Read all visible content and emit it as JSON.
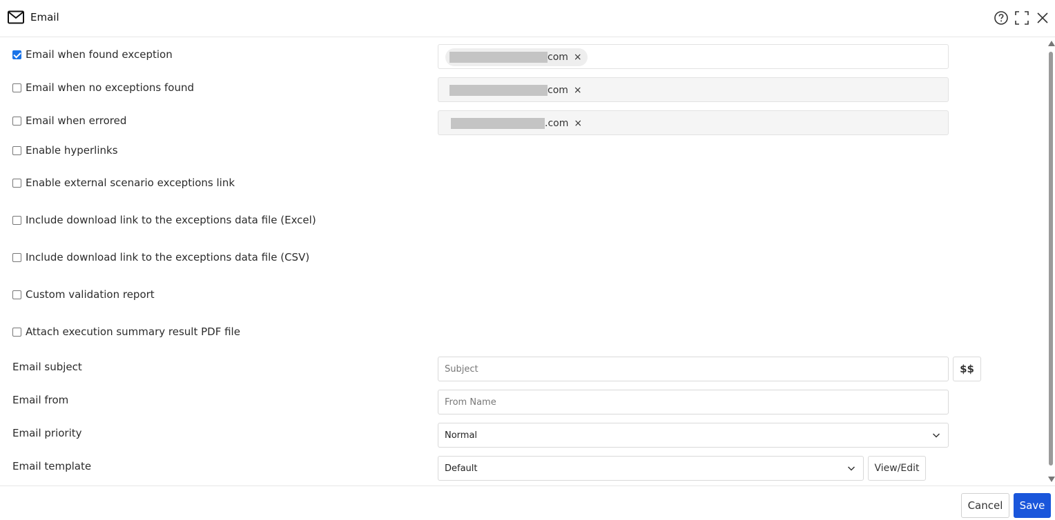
{
  "header": {
    "title": "Email",
    "icons": [
      "mail-icon",
      "help-icon",
      "fullscreen-icon",
      "close-icon"
    ]
  },
  "options": [
    {
      "label": "Email when found exception",
      "checked": true
    },
    {
      "label": "Email when no exceptions found",
      "checked": false
    },
    {
      "label": "Email when errored",
      "checked": false
    },
    {
      "label": "Enable hyperlinks",
      "checked": false
    },
    {
      "label": "Enable external scenario exceptions link",
      "checked": false
    },
    {
      "label": "Include download link to the exceptions data file (Excel)",
      "checked": false
    },
    {
      "label": "Include download link to the exceptions data file (CSV)",
      "checked": false
    },
    {
      "label": "Custom validation report",
      "checked": false
    },
    {
      "label": "Attach execution summary result PDF file",
      "checked": false
    }
  ],
  "recipients": [
    {
      "suffix": "com",
      "remove": "×"
    },
    {
      "suffix": "com",
      "remove": "×"
    },
    {
      "suffix": ".com",
      "remove": "×"
    }
  ],
  "fields": {
    "subject": {
      "label": "Email subject",
      "placeholder": "Subject",
      "value": "",
      "vars_button": "$$"
    },
    "from": {
      "label": "Email from",
      "placeholder": "From Name",
      "value": ""
    },
    "priority": {
      "label": "Email priority",
      "value": "Normal"
    },
    "template": {
      "label": "Email template",
      "value": "Default",
      "edit_button": "View/Edit"
    }
  },
  "footer": {
    "cancel": "Cancel",
    "save": "Save"
  },
  "colors": {
    "primary": "#1a56db",
    "checkbox_checked": "#1a73e8"
  }
}
